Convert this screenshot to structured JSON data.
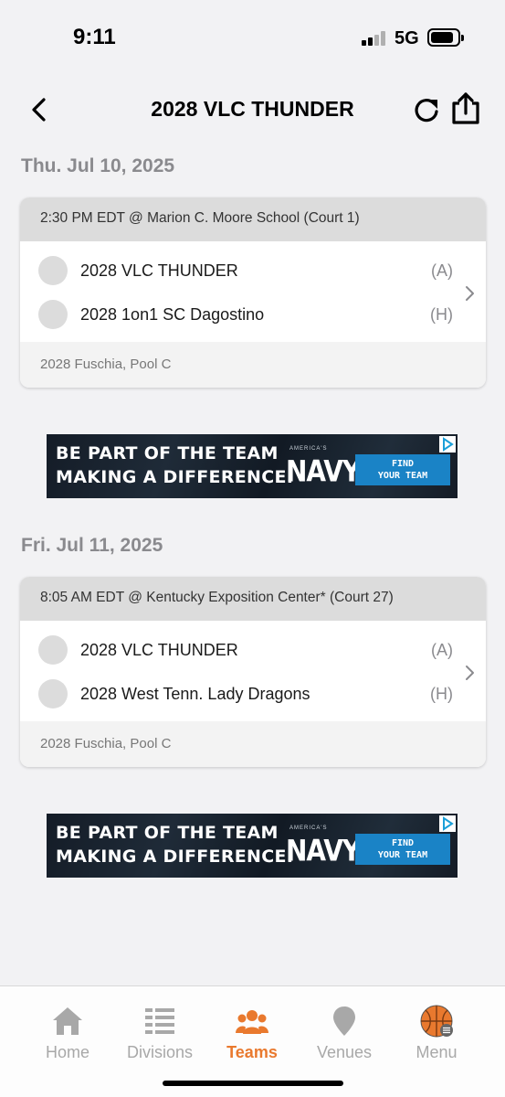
{
  "status": {
    "time": "9:11",
    "network": "5G"
  },
  "header": {
    "title": "2028 VLC THUNDER"
  },
  "days": [
    {
      "date": "Thu. Jul 10, 2025",
      "game": {
        "header": "2:30 PM EDT @ Marion C. Moore School (Court 1)",
        "teams": [
          {
            "name": "2028 VLC THUNDER",
            "tag": "(A)"
          },
          {
            "name": "2028 1on1 SC Dagostino",
            "tag": "(H)"
          }
        ],
        "footer": "2028 Fuschia, Pool C"
      }
    },
    {
      "date": "Fri. Jul 11, 2025",
      "game": {
        "header": "8:05 AM EDT @ Kentucky Exposition Center* (Court 27)",
        "teams": [
          {
            "name": "2028 VLC THUNDER",
            "tag": "(A)"
          },
          {
            "name": "2028 West Tenn. Lady Dragons",
            "tag": "(H)"
          }
        ],
        "footer": "2028 Fuschia, Pool C"
      }
    }
  ],
  "ad": {
    "line1": "BE PART OF THE TEAM",
    "line2": "MAKING A DIFFERENCE.",
    "small": "AMERICA'S",
    "brand": "NAVY",
    "cta_line1": "FIND",
    "cta_line2": "YOUR TEAM"
  },
  "tabs": [
    {
      "label": "Home",
      "icon": "home-icon"
    },
    {
      "label": "Divisions",
      "icon": "divisions-icon"
    },
    {
      "label": "Teams",
      "icon": "teams-icon"
    },
    {
      "label": "Venues",
      "icon": "venue-pin-icon"
    },
    {
      "label": "Menu",
      "icon": "basketball-menu-icon"
    }
  ],
  "active_tab": "Teams",
  "colors": {
    "accent": "#e9792e",
    "ad_button": "#1a83c6",
    "inactive": "#a8a8a8"
  }
}
